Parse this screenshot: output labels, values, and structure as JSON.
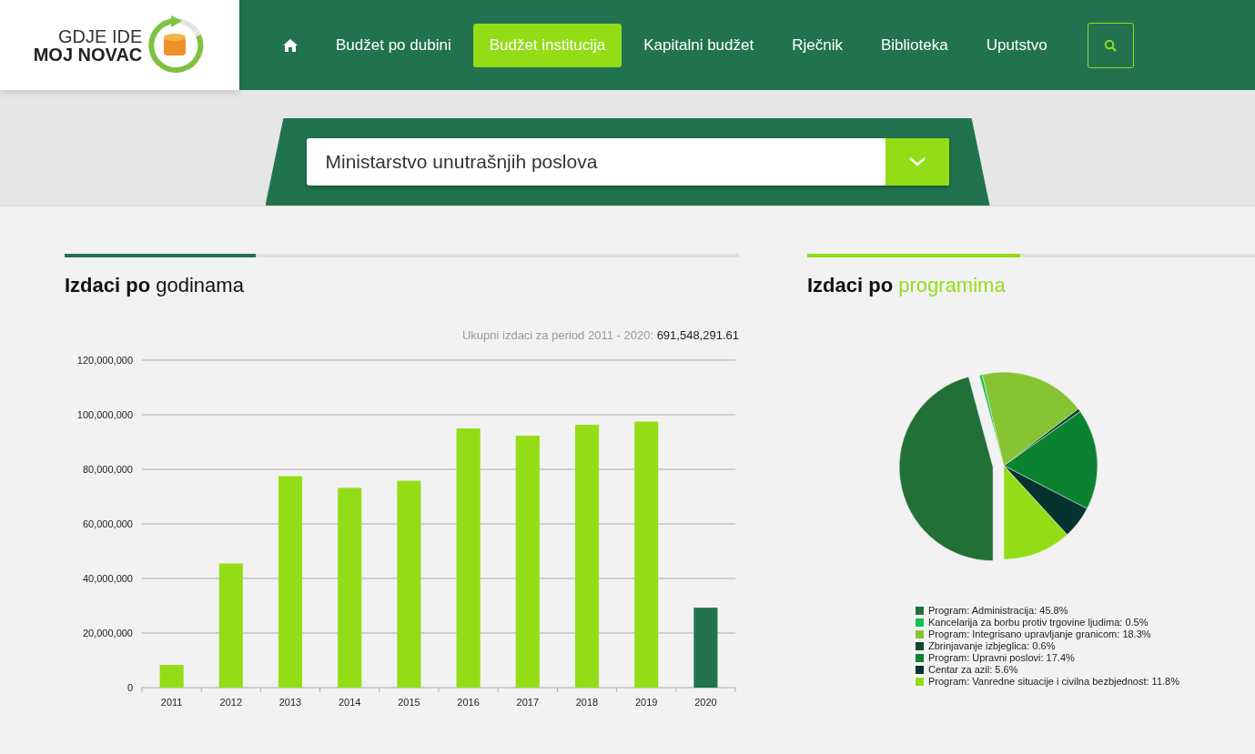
{
  "logo": {
    "line_1": "GDJE IDE",
    "line_2": "MOJ NOVAC"
  },
  "nav": [
    {
      "kind": "home",
      "selected": false
    },
    {
      "kind": "text",
      "label": "Budžet po dubini",
      "selected": false
    },
    {
      "kind": "text",
      "label": "Budžet institucija",
      "selected": true
    },
    {
      "kind": "text",
      "label": "Kapitalni budžet",
      "selected": false
    },
    {
      "kind": "text",
      "label": "Rječnik",
      "selected": false
    },
    {
      "kind": "text",
      "label": "Biblioteka",
      "selected": false
    },
    {
      "kind": "text",
      "label": "Uputstvo",
      "selected": false
    }
  ],
  "institution_select": {
    "value": "Ministarstvo unutrašnjih poslova"
  },
  "expenses_by_year": {
    "title": "**Izdaci po** godinama",
    "total_label": "Ukupni izdaci za period 2011 - 2020:",
    "total_value": "691,548,291.61",
    "chart_data": {
      "type": "bar",
      "categories": [
        "2011",
        "2012",
        "2013",
        "2014",
        "2015",
        "2016",
        "2017",
        "2018",
        "2019",
        "2020"
      ],
      "series": [
        {
          "color": "#93dd17",
          "values": [
            8300000,
            45500000,
            77500000,
            73200000,
            75800000,
            95000000,
            92300000,
            96300000,
            97500000,
            null
          ]
        },
        {
          "color": "#217350",
          "values": [
            null,
            null,
            null,
            null,
            null,
            null,
            null,
            null,
            null,
            29300000
          ]
        }
      ],
      "stacked": true,
      "grid": true,
      "ylim": [
        0,
        120000000
      ],
      "yticks": [
        {
          "value": 0,
          "label": "0"
        },
        {
          "value": 20000000,
          "label": "20,000,000"
        },
        {
          "value": 40000000,
          "label": "40,000,000"
        },
        {
          "value": 60000000,
          "label": "60,000,000"
        },
        {
          "value": 80000000,
          "label": "80,000,000"
        },
        {
          "value": 100000000,
          "label": "100,000,000"
        },
        {
          "value": 120000000,
          "label": "120,000,000"
        }
      ]
    }
  },
  "expenses_by_program": {
    "title_bold": "Izdaci po",
    "title_accent": "programima",
    "chart_data": {
      "type": "pie",
      "categories": [
        "Program: Administracija: 45.8%",
        "Kancelarija za borbu protiv trgovine ljudima: 0.5%",
        "Program: Integrisano upravljanje granicom: 18.3%",
        "Zbrinjavanje izbjeglica: 0.6%",
        "Program: Upravni poslovi: 17.4%",
        "Centar za azil: 5.6%",
        "Program: Vanredne situacije i civilna bezbjednost: 11.8%"
      ],
      "values": [
        45.8,
        0.5,
        18.3,
        0.6,
        17.4,
        5.6,
        11.8
      ],
      "legend": true,
      "colors": [
        "#217038",
        "#0ec24f",
        "#86c433",
        "#0b4a2c",
        "#0b822f",
        "#053330",
        "#93dd17"
      ]
    }
  }
}
